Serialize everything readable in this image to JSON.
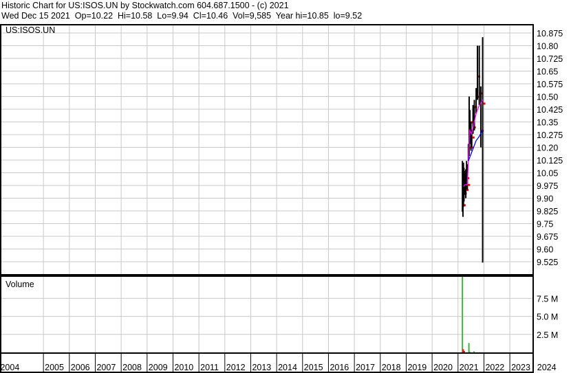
{
  "header": {
    "title": "Historic Chart for US:ISOS.UN by Stockwatch.com 604.687.1500 - (c) 2021",
    "summary": "Wed Dec 15 2021  Op=10.22  Hi=10.58  Lo=9.94  Cl=10.46  Vol=9,585  Year hi=10.85  lo=9.52"
  },
  "chart_data": {
    "type": "bar",
    "symbol_label": "US:ISOS.UN",
    "volume_label": "Volume",
    "colors": {
      "bars": "#000000",
      "close": "#ff0000",
      "ma_short": "#ff00ff",
      "ma_long": "#0000ff",
      "vol_up": "#3cb43c",
      "vol_down": "#ff0000",
      "grid": "#c8c8c8"
    },
    "price_axis": {
      "min": 9.525,
      "max": 10.875,
      "ticks": [
        "10.875",
        "10.80",
        "10.725",
        "10.65",
        "10.575",
        "10.50",
        "10.425",
        "10.35",
        "10.275",
        "10.20",
        "10.125",
        "10.05",
        "9.975",
        "9.90",
        "9.825",
        "9.75",
        "9.675",
        "9.60",
        "9.525"
      ]
    },
    "volume_axis": {
      "min": 0,
      "max": 10500000,
      "ticks": [
        {
          "v": 7500000,
          "label": "7.5 M"
        },
        {
          "v": 5000000,
          "label": "5.0 M"
        },
        {
          "v": 2500000,
          "label": "2.5 M"
        }
      ]
    },
    "x_axis": {
      "start": 2003.35,
      "end": 2023.9,
      "years": [
        "2004",
        "2005",
        "2006",
        "2007",
        "2008",
        "2009",
        "2010",
        "2011",
        "2012",
        "2013",
        "2014",
        "2015",
        "2016",
        "2017",
        "2018",
        "2019",
        "2020",
        "2021",
        "2022",
        "2023",
        "2024"
      ]
    },
    "price_bars": [
      [
        2021.17,
        10.12,
        9.82,
        9.95
      ],
      [
        2021.19,
        10.1,
        9.79,
        9.86
      ],
      [
        2021.21,
        10.11,
        9.85,
        10.0
      ],
      [
        2021.23,
        10.08,
        9.88,
        9.93
      ],
      [
        2021.25,
        10.06,
        9.92,
        9.97
      ],
      [
        2021.27,
        10.05,
        9.93,
        9.96
      ],
      [
        2021.3,
        10.07,
        9.9,
        9.95
      ],
      [
        2021.33,
        10.12,
        9.98,
        10.02
      ],
      [
        2021.36,
        10.1,
        9.95,
        9.98
      ],
      [
        2021.4,
        10.22,
        10.12,
        10.2
      ],
      [
        2021.43,
        10.5,
        10.15,
        10.3
      ],
      [
        2021.46,
        10.42,
        10.22,
        10.35
      ],
      [
        2021.5,
        10.35,
        10.18,
        10.2
      ],
      [
        2021.53,
        10.3,
        10.2,
        10.26
      ],
      [
        2021.58,
        10.45,
        10.28,
        10.32
      ],
      [
        2021.63,
        10.48,
        10.3,
        10.44
      ],
      [
        2021.7,
        10.55,
        10.4,
        10.5
      ],
      [
        2021.75,
        10.8,
        10.48,
        10.62
      ],
      [
        2021.82,
        10.8,
        10.45,
        10.52
      ],
      [
        2021.88,
        10.56,
        10.2,
        10.3
      ],
      [
        2021.95,
        10.85,
        9.52,
        10.46
      ]
    ],
    "ma_short": [
      [
        2021.21,
        9.97
      ],
      [
        2021.28,
        9.98
      ],
      [
        2021.36,
        9.98
      ],
      [
        2021.4,
        10.12
      ],
      [
        2021.45,
        10.3
      ],
      [
        2021.52,
        10.28
      ],
      [
        2021.6,
        10.33
      ],
      [
        2021.7,
        10.4
      ],
      [
        2021.8,
        10.44
      ],
      [
        2021.95,
        10.48
      ]
    ],
    "ma_long": [
      [
        2021.4,
        10.12
      ],
      [
        2021.5,
        10.16
      ],
      [
        2021.6,
        10.2
      ],
      [
        2021.7,
        10.24
      ],
      [
        2021.8,
        10.26
      ],
      [
        2021.95,
        10.3
      ]
    ],
    "volume_bars": [
      [
        2021.17,
        10500000,
        "up"
      ],
      [
        2021.2,
        450000,
        "down"
      ],
      [
        2021.24,
        200000,
        "down"
      ],
      [
        2021.42,
        1300000,
        "up"
      ],
      [
        2021.45,
        120000,
        "up"
      ],
      [
        2021.62,
        150000,
        "up"
      ]
    ]
  }
}
